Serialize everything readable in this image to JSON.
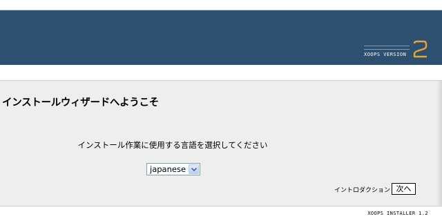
{
  "header": {
    "version_label": "XOOPS VERSION",
    "version_number": "2",
    "background": "#2d5070",
    "accent": "#e8a532"
  },
  "main": {
    "title": "インストールウィザードへようこそ",
    "language_prompt": "インストール作業に使用する言語を選択してください",
    "language_select": {
      "value": "japanese"
    },
    "navigation": {
      "next_page_label": "イントロダクション >>",
      "next_button_label": "次へ"
    }
  },
  "footer": {
    "installer_label": "XOOPS INSTALLER 1.2"
  }
}
